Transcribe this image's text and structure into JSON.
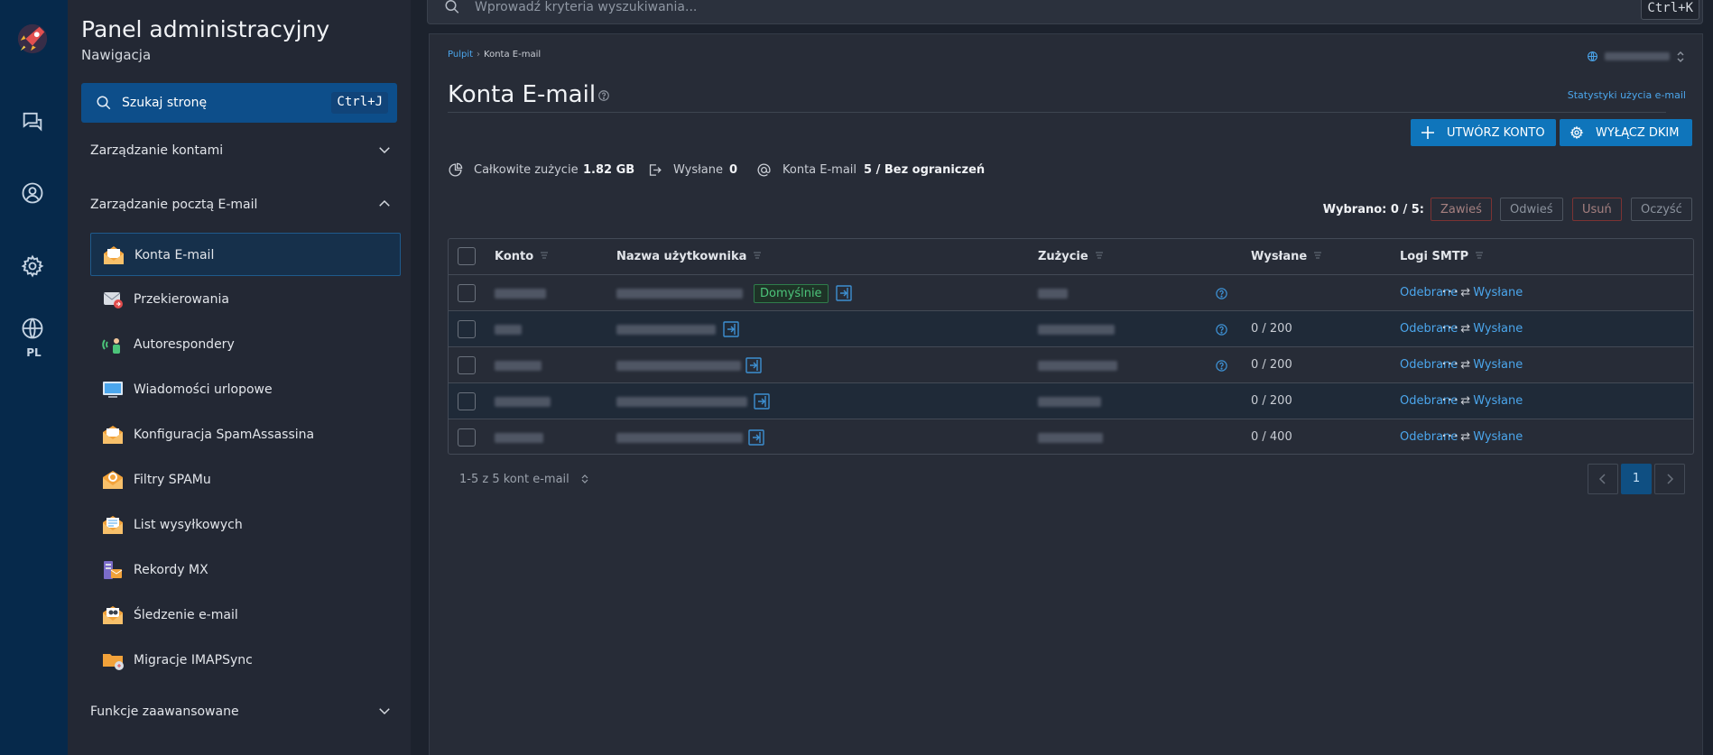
{
  "rail": {
    "icons": [
      "rocket-logo",
      "chat-icon",
      "user-icon",
      "gear-icon",
      "globe-icon"
    ],
    "language": "PL"
  },
  "sidebar": {
    "title": "Panel administracyjny",
    "subtitle": "Nawigacja",
    "search": {
      "label": "Szukaj stronę",
      "shortcut": "Ctrl+J"
    },
    "sections": [
      {
        "label": "Zarządzanie kontami",
        "expanded": false
      },
      {
        "label": "Zarządzanie pocztą E-mail",
        "expanded": true
      },
      {
        "label": "Funkcje zaawansowane",
        "expanded": false
      }
    ],
    "items": [
      {
        "label": "Konta E-mail",
        "active": true
      },
      {
        "label": "Przekierowania"
      },
      {
        "label": "Autorespondery"
      },
      {
        "label": "Wiadomości urlopowe"
      },
      {
        "label": "Konfiguracja SpamAssassina"
      },
      {
        "label": "Filtry SPAMu"
      },
      {
        "label": "List wysyłkowych"
      },
      {
        "label": "Rekordy MX"
      },
      {
        "label": "Śledzenie e-mail"
      },
      {
        "label": "Migracje IMAPSync"
      }
    ]
  },
  "topbar": {
    "search_placeholder": "Wprowadź kryteria wyszukiwania...",
    "shortcut": "Ctrl+K"
  },
  "main": {
    "breadcrumb": [
      "Pulpit",
      "Konta E-mail"
    ],
    "title": "Konta E-mail",
    "stats_link": "Statystyki użycia e-mail",
    "buttons": {
      "create": "UTWÓRZ KONTO",
      "dkim": "WYŁĄCZ DKIM"
    },
    "summary": {
      "usage_label": "Całkowite zużycie",
      "usage_value": "1.82 GB",
      "sent_label": "Wysłane",
      "sent_value": "0",
      "accounts_label": "Konta E-mail",
      "accounts_value": "5 / Bez ograniczeń"
    },
    "selection": {
      "label": "Wybrano: 0 / 5:",
      "suspend": "Zawieś",
      "unsuspend": "Odwieś",
      "delete": "Usuń",
      "clear": "Oczyść"
    },
    "table": {
      "columns": [
        "Konto",
        "Nazwa użytkownika",
        "Zużycie",
        "Wysłane",
        "Logi SMTP"
      ],
      "default_badge": "Domyślnie",
      "smtp_received": "Odebrane",
      "smtp_arrow": "⇄",
      "smtp_sent": "Wysłane",
      "rows": [
        {
          "sent": "",
          "default": true,
          "help": true
        },
        {
          "sent": "0 / 200",
          "default": false,
          "help": true
        },
        {
          "sent": "0 / 200",
          "default": false,
          "help": true
        },
        {
          "sent": "0 / 200",
          "default": false,
          "help": false
        },
        {
          "sent": "0 / 400",
          "default": false,
          "help": false
        }
      ]
    },
    "footer": {
      "count": "1-5 z 5 kont e-mail",
      "page": "1"
    }
  },
  "colors": {
    "accent": "#0f75bb",
    "rail": "#06294b",
    "link": "#4ba6ec",
    "success": "#4cc47a"
  }
}
